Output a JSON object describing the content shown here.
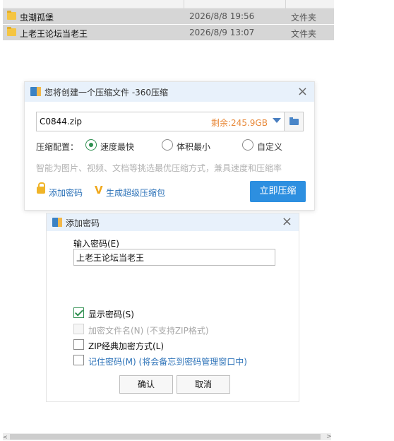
{
  "files": {
    "rows": [
      {
        "name": "虫潮孤堡",
        "date": "2026/8/8 19:56",
        "type": "文件夹"
      },
      {
        "name": "上老王论坛当老王",
        "date": "2026/8/9 13:07",
        "type": "文件夹"
      }
    ]
  },
  "compress_dialog": {
    "title": "您将创建一个压缩文件 -360压缩",
    "close_icon": "×",
    "filename": "C0844.zip",
    "free_space": "剩余:245.9GB",
    "config_label": "压缩配置：",
    "options": [
      "速度最快",
      "体积最小",
      "自定义"
    ],
    "selected_option": "速度最快",
    "hint": "智能为图片、视频、文档等挑选最优压缩方式，兼具速度和压缩率",
    "add_password": "添加密码",
    "v_icon": "V",
    "generate_package": "生成超级压缩包",
    "compress_now": "立即压缩"
  },
  "password_dialog": {
    "title": "添加密码",
    "close_icon": "×",
    "input_label": "输入密码(E)",
    "password_value": "上老王论坛当老王",
    "checkboxes": [
      {
        "label": "显示密码(S)",
        "checked": true,
        "disabled": false
      },
      {
        "label": "加密文件名(N) (不支持ZIP格式)",
        "checked": false,
        "disabled": true
      },
      {
        "label": "ZIP经典加密方式(L)",
        "checked": false,
        "disabled": false
      },
      {
        "label": "记住密码(M) (将会备忘到密码管理窗口中)",
        "checked": false,
        "disabled": false
      }
    ],
    "ok_button": "确认",
    "cancel_button": "取消"
  },
  "colors": {
    "accent": "#2d8fe0",
    "link": "#2c72b8",
    "free_space": "#e8893a",
    "check_green": "#2f8f50"
  }
}
